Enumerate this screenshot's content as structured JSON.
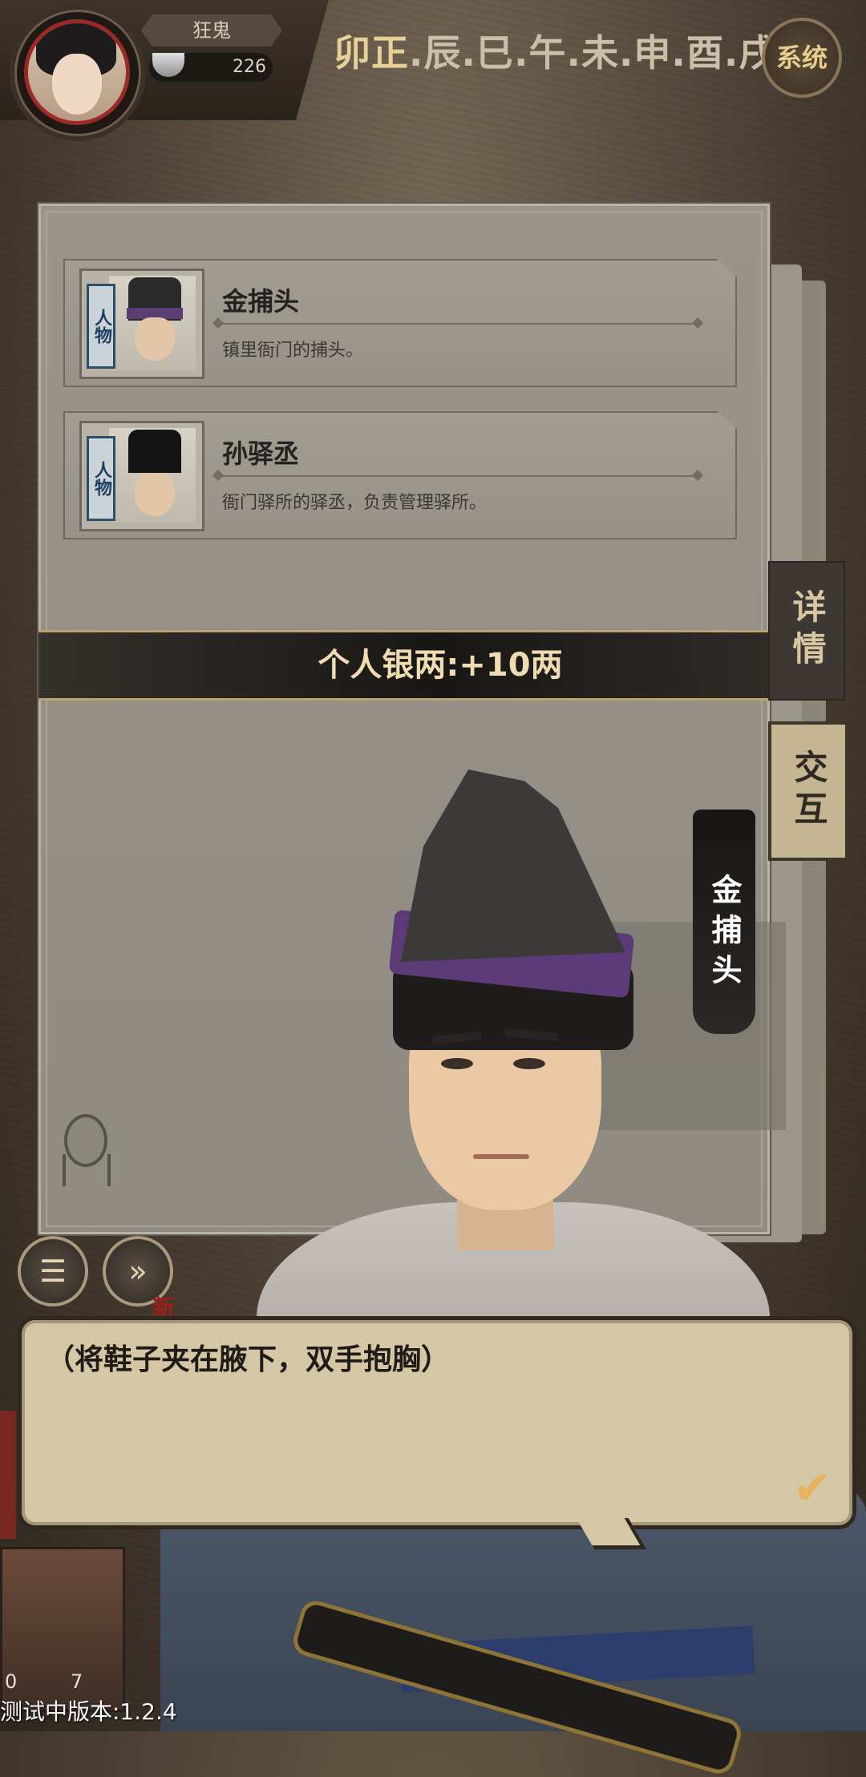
{
  "player": {
    "name": "狂鬼",
    "silver": "226"
  },
  "timeline": {
    "periods": [
      "卯",
      "正",
      ".",
      "辰",
      ".",
      "巳",
      ".",
      "午",
      ".",
      "未",
      ".",
      "申",
      ".",
      "酉",
      ".",
      "戌"
    ],
    "current_index": 0,
    "system_button": "系统"
  },
  "characters": [
    {
      "tag": "人物",
      "name": "金捕头",
      "desc": "镇里衙门的捕头。"
    },
    {
      "tag": "人物",
      "name": "孙驿丞",
      "desc": "衙门驿所的驿丞，负责管理驿所。"
    }
  ],
  "banner": {
    "text": "个人银两:+10两"
  },
  "tabs": {
    "detail": "详情",
    "interact": "交互"
  },
  "speaker": {
    "name": "金捕头"
  },
  "buttons": {
    "log": "log-icon",
    "fast_forward": "fast-forward-icon",
    "new_badge": "新"
  },
  "dialog": {
    "text": "（将鞋子夹在腋下，双手抱胸）",
    "confirm": "✔"
  },
  "bottom": {
    "stat_a": "0",
    "stat_b": "7",
    "version": "测试中版本:1.2.4"
  },
  "colors": {
    "accent": "#e6cf98",
    "badge_red": "#9a1f1a",
    "dialog_bg": "#d5c6a6"
  }
}
